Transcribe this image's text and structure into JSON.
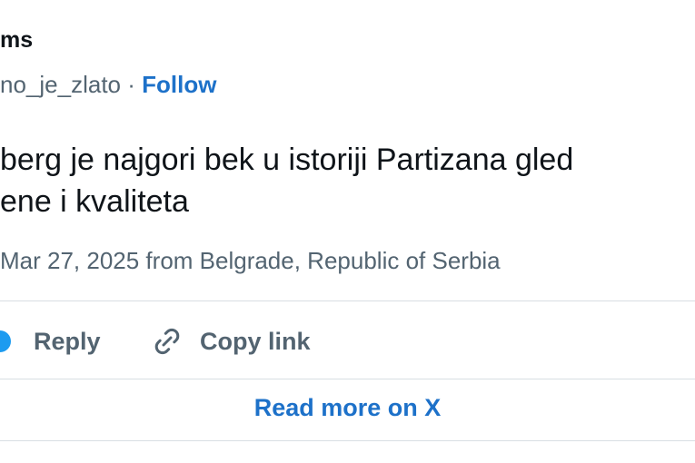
{
  "tweet": {
    "author_name": "ms",
    "handle": "no_je_zlato",
    "handle_separator": " · ",
    "follow_label": "Follow",
    "text_line1": "berg je najgori bek u istoriji Partizana gled",
    "text_line2": "ene i kvaliteta",
    "meta": "Mar 27, 2025 from Belgrade, Republic of Serbia"
  },
  "actions": {
    "reply_label": "Reply",
    "copy_link_label": "Copy link",
    "heart_icon": "heart-icon",
    "link_icon": "link-icon"
  },
  "footer": {
    "read_more_label": "Read more on X"
  },
  "colors": {
    "text": "#0f1419",
    "secondary": "#536471",
    "link": "#1d71c9",
    "accent": "#1d9bf0",
    "divider": "#d8dee3"
  }
}
